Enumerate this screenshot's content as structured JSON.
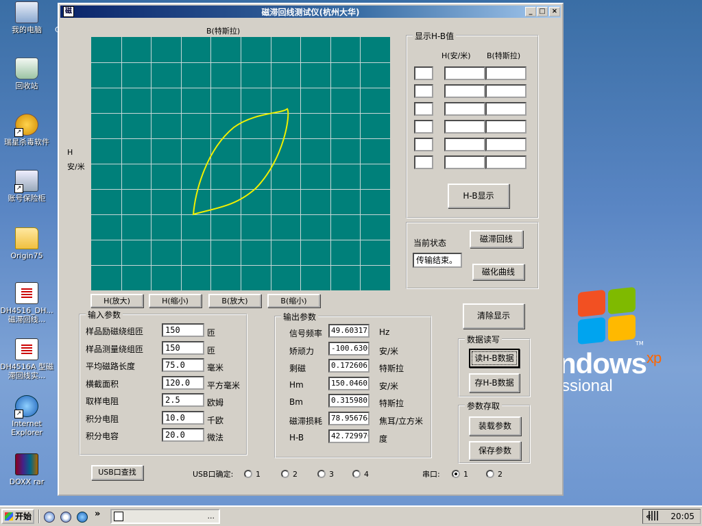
{
  "desktop": {
    "icons": [
      {
        "label": "我的电脑"
      },
      {
        "label": "回收站"
      },
      {
        "label": "瑞星杀毒软件"
      },
      {
        "label": "账号保险柜"
      },
      {
        "label": "Origin75"
      },
      {
        "label": "DH4516_DH... 磁滞回线..."
      },
      {
        "label": "DH4516A 型磁滞回线实..."
      },
      {
        "label": "Internet Explorer"
      },
      {
        "label": "DOXX rar"
      }
    ],
    "stray_label": "C",
    "xp_logo": {
      "word": "ndows",
      "suffix": "xp",
      "tm": "TM",
      "sub": "ssional"
    }
  },
  "window": {
    "title": "磁滞回线测试仪(杭州大华)",
    "app_icon": "磁",
    "controls": {
      "minimize": "_",
      "maximize": "□",
      "close": "×"
    },
    "plot": {
      "y_axis_label": "B(特斯拉)",
      "x_axis_label_line1": "H",
      "x_axis_label_line2": "安/米",
      "background": "#00807a",
      "grid_color": "#c8d8d8",
      "curve_color": "#f0f000"
    },
    "zoom_buttons": [
      "H(放大)",
      "H(缩小)",
      "B(放大)",
      "B(缩小)"
    ],
    "hb_panel": {
      "legend": "显示H-B值",
      "col_h": "H(安/米)",
      "col_b": "B(特斯拉)",
      "rows": 6,
      "button": "H-B显示"
    },
    "status_panel": {
      "label": "当前状态",
      "value": "传输结束。",
      "hysteresis_button": "磁滞回线",
      "magnetization_button": "磁化曲线"
    },
    "input_params": {
      "legend": "输入参数",
      "rows": [
        {
          "label": "样品励磁绕组匝",
          "value": "150",
          "unit": "匝"
        },
        {
          "label": "样品测量绕组匝",
          "value": "150",
          "unit": "匝"
        },
        {
          "label": "平均磁路长度",
          "value": "75.0",
          "unit": "毫米"
        },
        {
          "label": "横截面积",
          "value": "120.0",
          "unit": "平方毫米"
        },
        {
          "label": "取样电阻",
          "value": "2.5",
          "unit": "欧姆"
        },
        {
          "label": "积分电阻",
          "value": "10.0",
          "unit": "千欧"
        },
        {
          "label": "积分电容",
          "value": "20.0",
          "unit": "微法"
        }
      ]
    },
    "output_params": {
      "legend": "输出参数",
      "rows": [
        {
          "label": "信号频率",
          "value": "49.603175",
          "unit": "Hz"
        },
        {
          "label": "矫顽力",
          "value": "-100.6300",
          "unit": "安/米"
        },
        {
          "label": "剩磁",
          "value": "0.172606",
          "unit": "特斯拉"
        },
        {
          "label": "Hm",
          "value": "150.04605",
          "unit": "安/米"
        },
        {
          "label": "Bm",
          "value": "0.315980",
          "unit": "特斯拉"
        },
        {
          "label": "磁滞损耗",
          "value": "78.956764",
          "unit": "焦耳/立方米"
        },
        {
          "label": "H-B",
          "value": "42.729970",
          "unit": "度"
        }
      ]
    },
    "clear_button": "清除显示",
    "data_rw": {
      "legend": "数据读写",
      "read": "读H-B数据",
      "save": "存H-B数据"
    },
    "param_store": {
      "legend": "参数存取",
      "load": "装载参数",
      "save": "保存参数"
    },
    "usb_find_button": "USB口查找",
    "usb_confirm": {
      "label": "USB口确定:",
      "options": [
        "1",
        "2",
        "3",
        "4"
      ],
      "selected": null
    },
    "serial": {
      "label": "串口:",
      "options": [
        "1",
        "2"
      ],
      "selected": "1"
    }
  },
  "taskbar": {
    "start_label": "开始",
    "quick_launch_more": "»",
    "task_label": "...",
    "tray_arrow": "«",
    "clock": "20:05"
  }
}
